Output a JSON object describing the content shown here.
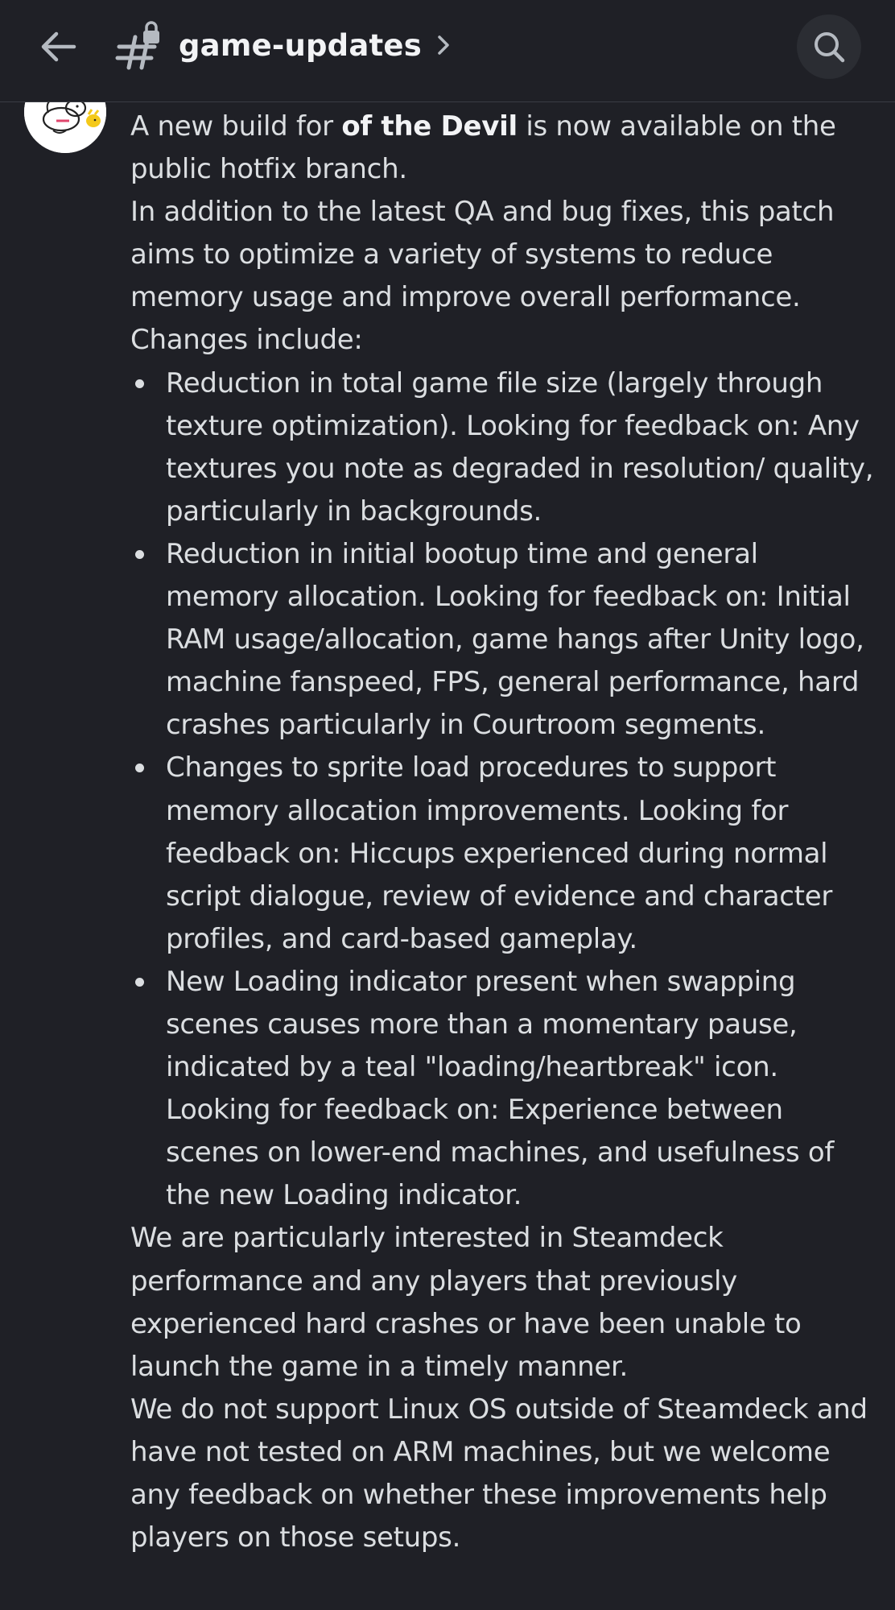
{
  "header": {
    "channel_name": "game-updates",
    "back_icon": "arrow-left-icon",
    "channel_icon": "hash-lock-icon",
    "chevron_icon": "chevron-right-icon",
    "search_icon": "search-icon"
  },
  "message": {
    "intro_prefix": "A new build for ",
    "intro_bold": "of the Devil",
    "intro_suffix": " is now available on the public hotfix branch.",
    "paragraph_2": "In addition to the latest QA and bug fixes, this patch aims to optimize a variety of systems to reduce memory usage and improve overall performance.",
    "changes_heading": "Changes include:",
    "changes": [
      "Reduction in total game file size (largely through texture optimization). Looking for feedback on: Any textures you note as degraded in resolution/ quality, particularly in backgrounds.",
      "Reduction in initial bootup time and general memory allocation. Looking for feedback on: Initial RAM usage/allocation, game hangs after Unity logo, machine fanspeed, FPS, general performance, hard crashes particularly in Courtroom segments.",
      "Changes to sprite load procedures to support memory allocation improvements. Looking for feedback on: Hiccups experienced during normal script dialogue, review of evidence and character profiles, and card-based gameplay.",
      "New Loading indicator present when swapping scenes causes more than a momentary pause, indicated by a teal \"loading/heartbreak\" icon. Looking for feedback on: Experience between scenes on lower-end machines, and usefulness of the new Loading indicator."
    ],
    "paragraph_steamdeck": "We are particularly interested in Steamdeck performance and any players that previously experienced hard crashes or have been unable to launch the game in a timely manner.",
    "paragraph_linux": "We do not support Linux OS outside of Steamdeck and have not tested on ARM machines, but we welcome any feedback on whether these improvements help players on those setups."
  }
}
